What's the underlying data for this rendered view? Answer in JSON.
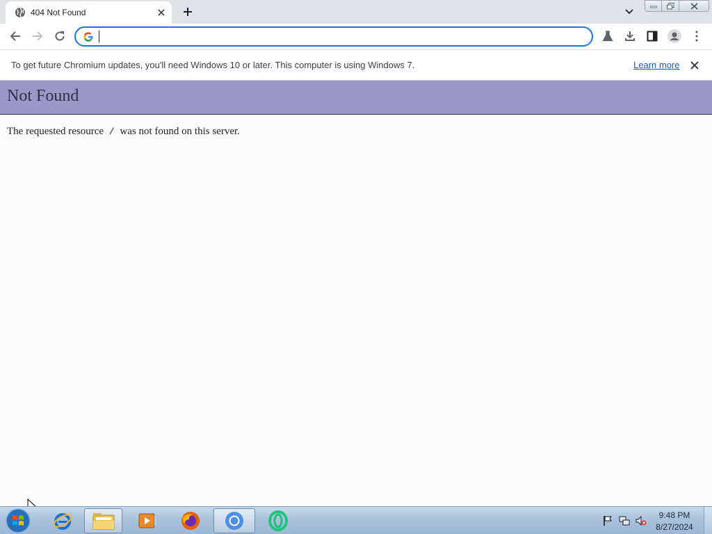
{
  "browser": {
    "tab": {
      "title": "404 Not Found",
      "favicon": "globe-icon"
    },
    "omnibox": {
      "value": "",
      "placeholder": ""
    },
    "infobar": {
      "message": "To get future Chromium updates, you'll need Windows 10 or later. This computer is using Windows 7.",
      "link": "Learn more"
    },
    "toolbar_icons": [
      "back-icon",
      "forward-icon",
      "reload-icon",
      "labs-flask-icon",
      "download-icon",
      "side-panel-icon",
      "profile-icon",
      "menu-icon"
    ]
  },
  "page": {
    "title": "Not Found",
    "message_before": "The requested resource",
    "resource": "/",
    "message_after": "was not found on this server.",
    "header_color": "#9b98c9"
  },
  "taskbar": {
    "items": [
      "start-orb-icon",
      "internet-explorer-icon",
      "file-explorer-icon",
      "media-player-icon",
      "firefox-icon",
      "chromium-icon",
      "opera-icon"
    ],
    "clock": {
      "time": "9:48 PM",
      "date": "8/27/2024"
    },
    "tray_icons": [
      "action-center-flag-icon",
      "network-icon",
      "volume-muted-icon"
    ]
  }
}
